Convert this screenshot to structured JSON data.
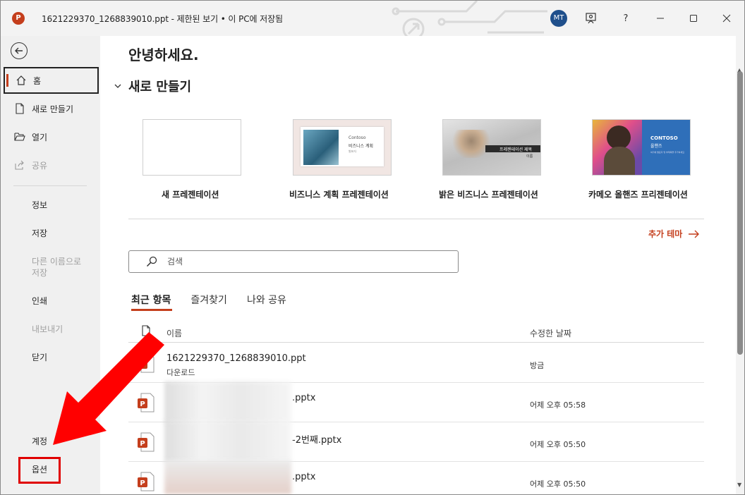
{
  "titlebar": {
    "app_icon_letter": "P",
    "title": "1621229370_1268839010.ppt  -  제한된 보기 • 이 PC에 저장됨",
    "avatar_initials": "MT",
    "help_label": "?",
    "icons": [
      "powerpoint-icon",
      "coauthor-icon",
      "help-icon",
      "minimize-icon",
      "maximize-icon",
      "close-icon"
    ]
  },
  "sidebar": {
    "home": "홈",
    "new": "새로 만들기",
    "open": "열기",
    "share": "공유",
    "info": "정보",
    "save": "저장",
    "save_as_line1": "다른 이름으로",
    "save_as_line2": "저장",
    "print": "인쇄",
    "export": "내보내기",
    "close": "닫기",
    "account": "계정",
    "options": "옵션"
  },
  "main": {
    "greeting": "안녕하세요.",
    "new_section_title": "새로 만들기",
    "templates": [
      {
        "label": "새 프레젠테이션"
      },
      {
        "label": "비즈니스 계획 프레젠테이션",
        "thumb_title": "Contoso",
        "thumb_sub": "비즈니스 계획",
        "thumb_small": "발표자"
      },
      {
        "label": "밝은 비즈니스 프레젠테이션",
        "thumb_title": "프레젠테이션 제목",
        "thumb_sub": "이름"
      },
      {
        "label": "카메오 올핸즈 프리젠테이션",
        "thumb_title": "CONTOSO",
        "thumb_sub": "올핸즈",
        "thumb_small": "여기에 발표자 및 부제목을 추가하세요"
      }
    ],
    "more_themes": "추가 테마",
    "search_placeholder": "검색",
    "tabs": [
      "최근 항목",
      "즐겨찾기",
      "나와 공유"
    ],
    "list_header": {
      "name": "이름",
      "date": "수정한 날짜"
    },
    "files": [
      {
        "name": "1621229370_1268839010.ppt",
        "location": "다운로드",
        "date": "방금"
      },
      {
        "name": ".pptx",
        "location": "",
        "date": "어제 오후 05:58"
      },
      {
        "name": "-2번째.pptx",
        "location": "",
        "date": "어제 오후 05:50"
      },
      {
        "name": ".pptx",
        "location": "",
        "date": "어제 오후 05:50"
      }
    ]
  },
  "colors": {
    "accent": "#c43e1c",
    "annotation_red": "#ff0000",
    "avatar": "#1f4f8b",
    "sidebar_bg": "#f0f0f0"
  }
}
